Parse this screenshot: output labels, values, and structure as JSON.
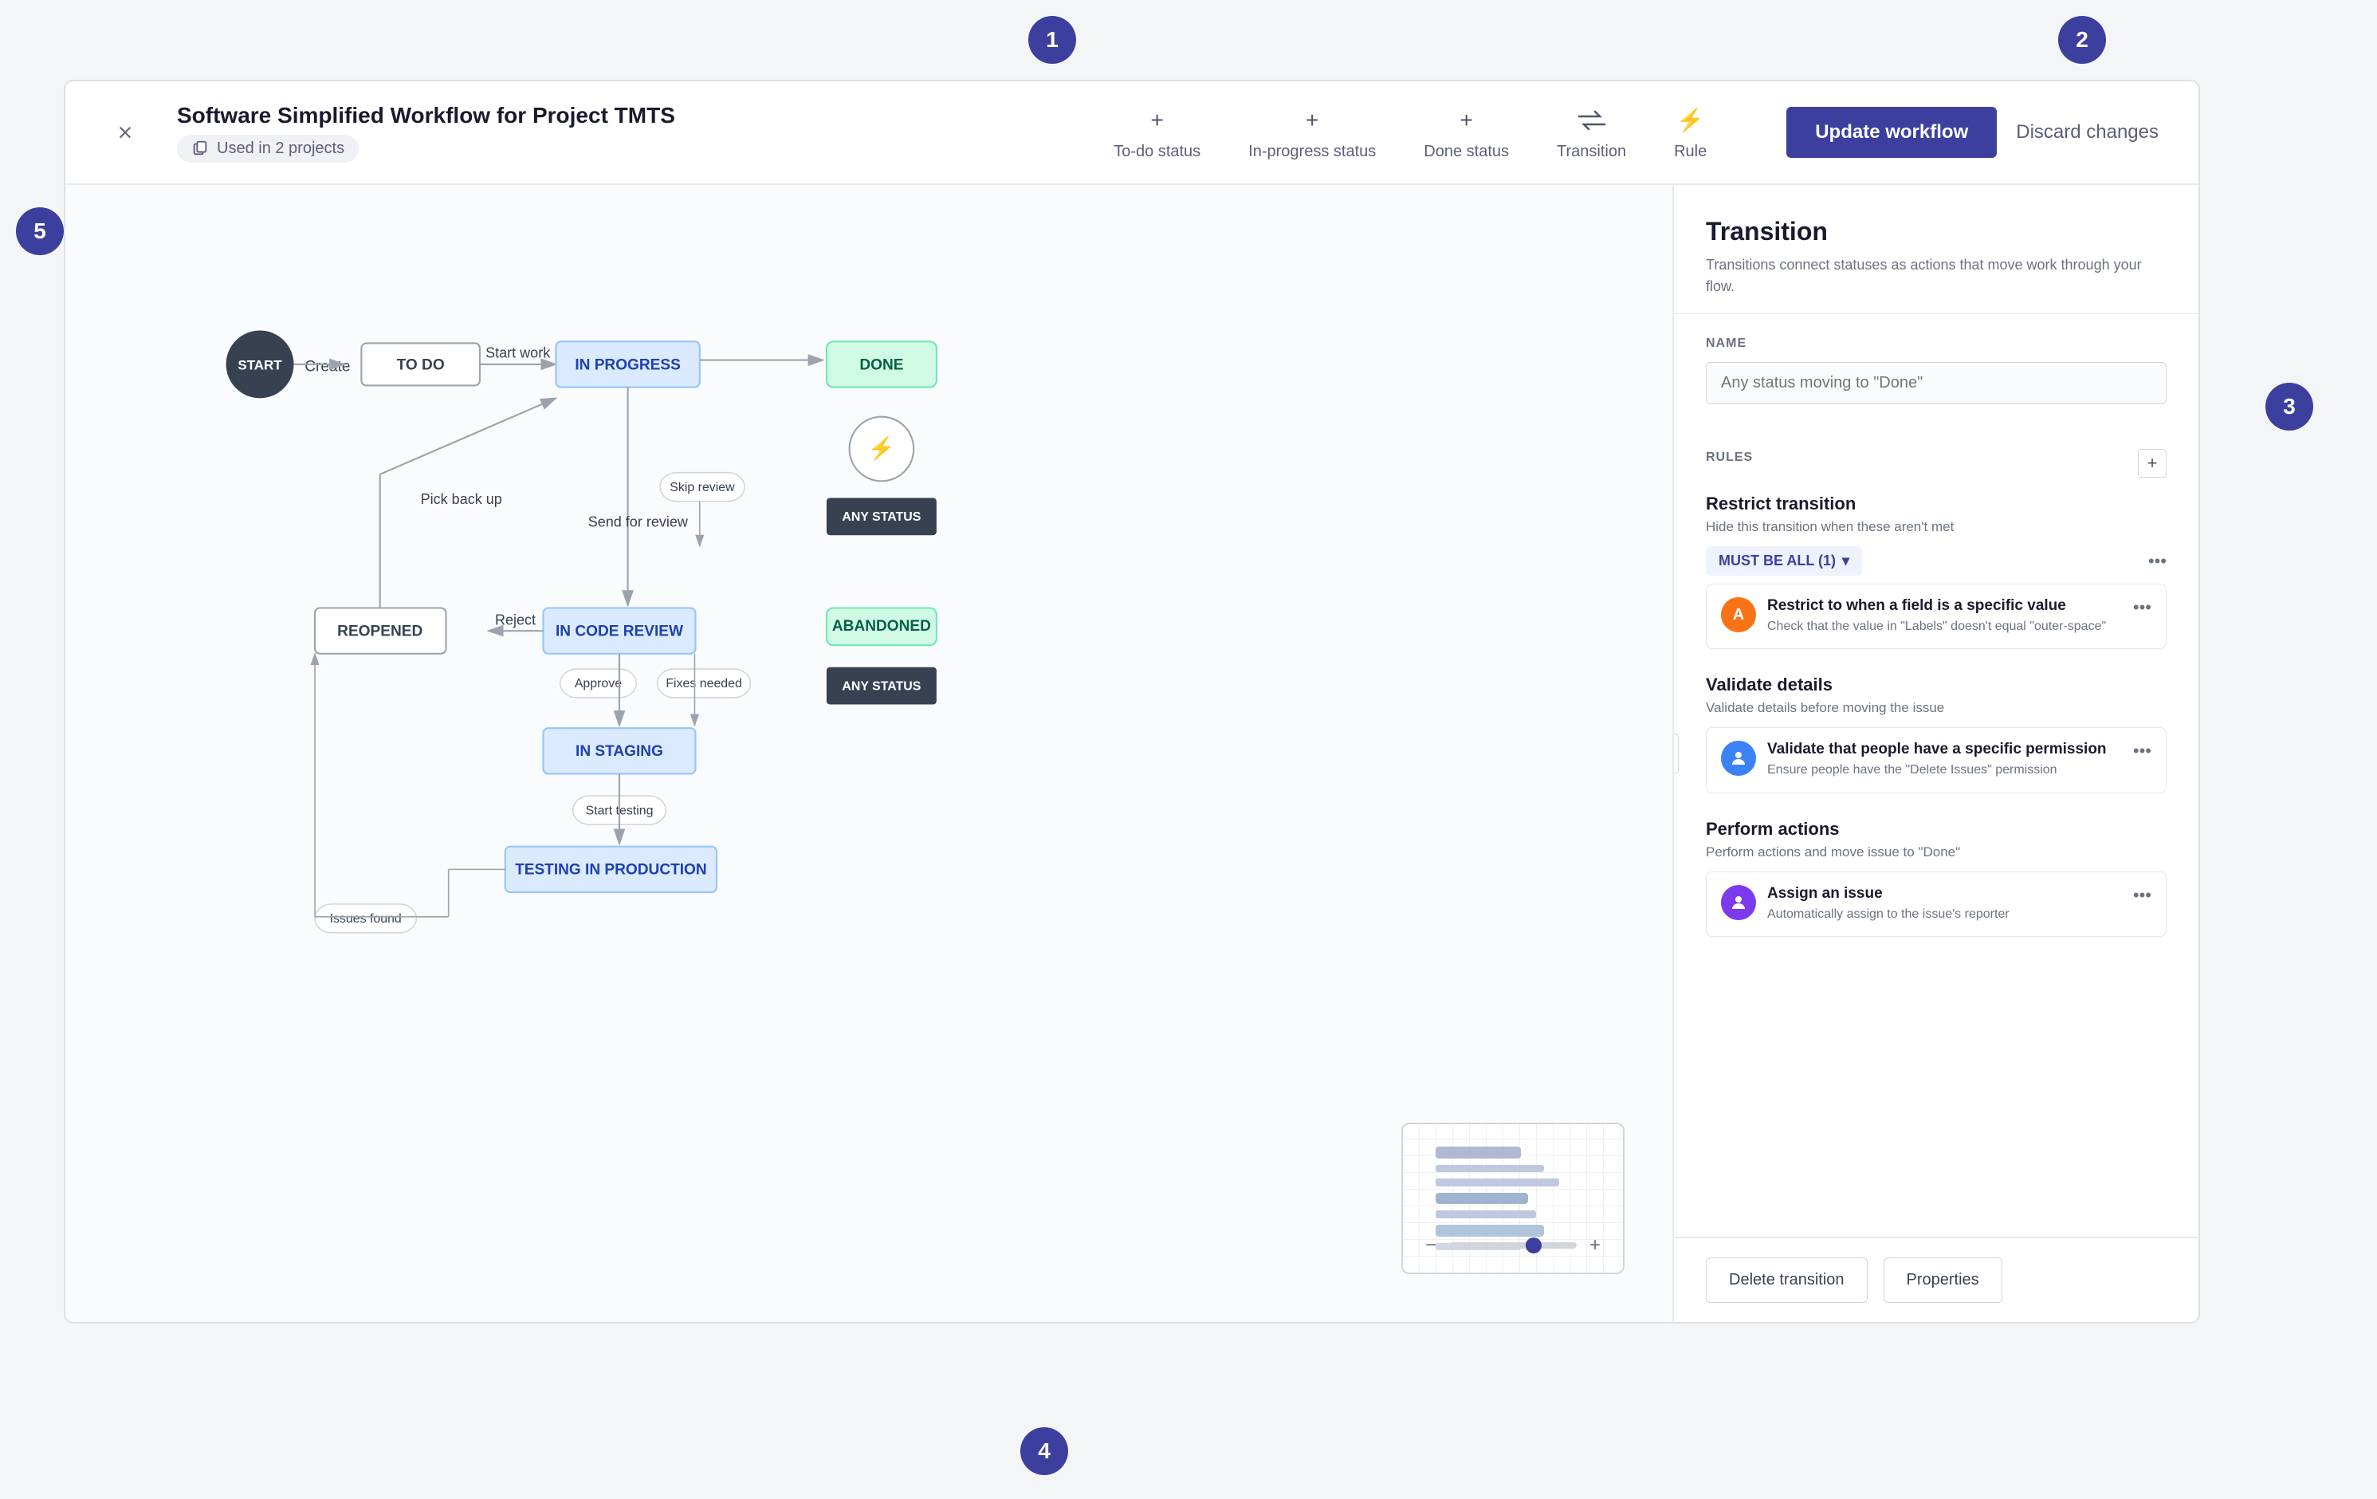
{
  "badges": {
    "b1": "1",
    "b2": "2",
    "b3": "3",
    "b4": "4",
    "b5": "5"
  },
  "header": {
    "close_label": "×",
    "title": "Software Simplified Workflow for Project TMTS",
    "used_in": "Used in 2 projects",
    "toolbar": [
      {
        "id": "todo",
        "icon": "+",
        "label": "To-do status"
      },
      {
        "id": "inprogress",
        "icon": "+",
        "label": "In-progress status"
      },
      {
        "id": "done",
        "icon": "+",
        "label": "Done status"
      },
      {
        "id": "transition",
        "icon": "⇄",
        "label": "Transition"
      },
      {
        "id": "rule",
        "icon": "⚡",
        "label": "Rule"
      }
    ],
    "update_btn": "Update workflow",
    "discard_btn": "Discard changes"
  },
  "panel": {
    "title": "Transition",
    "description": "Transitions connect statuses as actions that move work through your flow.",
    "name_label": "NAME",
    "name_placeholder": "Any status moving to \"Done\"",
    "rules_label": "RULES",
    "restrict_group": {
      "title": "Restrict transition",
      "desc": "Hide this transition when these aren't met",
      "badge": "MUST BE ALL (1)",
      "rule": {
        "icon": "A",
        "avatar_class": "rule-avatar-orange",
        "name": "Restrict to when a field is a specific value",
        "desc": "Check that the value in \"Labels\" doesn't equal \"outer-space\""
      }
    },
    "validate_group": {
      "title": "Validate details",
      "desc": "Validate details before moving the issue",
      "rule": {
        "icon": "👤",
        "avatar_class": "rule-avatar-blue",
        "name": "Validate that people have a specific permission",
        "desc": "Ensure people have the \"Delete Issues\" permission"
      }
    },
    "perform_group": {
      "title": "Perform actions",
      "desc": "Perform actions and move issue to \"Done\"",
      "rule": {
        "icon": "👤",
        "avatar_class": "rule-avatar-purple",
        "name": "Assign an issue",
        "desc": "Automatically assign to the issue's reporter"
      }
    },
    "delete_btn": "Delete transition",
    "properties_btn": "Properties"
  }
}
